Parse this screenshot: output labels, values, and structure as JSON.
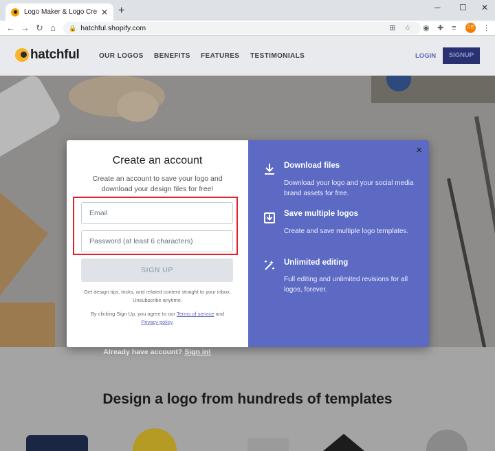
{
  "browser": {
    "tab_title": "Logo Maker & Logo Creator - H",
    "url": "hatchful.shopify.com",
    "profile_initials": "슈빈"
  },
  "site": {
    "logo_text": "hatchful",
    "nav": [
      "OUR LOGOS",
      "BENEFITS",
      "FEATURES",
      "TESTIMONIALS"
    ],
    "login_label": "LOGIN",
    "signup_label": "SIGNUP"
  },
  "modal": {
    "title": "Create an account",
    "subtitle": "Create an account to save your logo and download your design files for free!",
    "email_placeholder": "Email",
    "password_placeholder": "Password (at least 6 characters)",
    "signup_button": "SIGN UP",
    "tips_text": "Get design tips, tricks, and related content straight to your inbox. Unsubscribe anytime.",
    "agree_prefix": "By clicking Sign Up, you agree to our",
    "terms_link": "Terms of service",
    "agree_and": "and",
    "privacy_link": "Privacy policy",
    "agree_suffix": ".",
    "close_symbol": "×",
    "features": [
      {
        "icon": "download-icon",
        "title": "Download files",
        "description": "Download your logo and your social media brand assets for free."
      },
      {
        "icon": "save-icon",
        "title": "Save multiple logos",
        "description": "Create and save multiple logo templates."
      },
      {
        "icon": "edit-magic-icon",
        "title": "Unlimited editing",
        "description": "Full editing and unlimited revisions for all logos, forever."
      }
    ]
  },
  "already_account_text": "Already have account?",
  "sign_in_link": "Sign in!",
  "headline": "Design a logo from hundreds of templates",
  "colors": {
    "accent": "#5c6ac4",
    "signup_dark": "#2a3170",
    "highlight_red": "#e21f2a"
  }
}
